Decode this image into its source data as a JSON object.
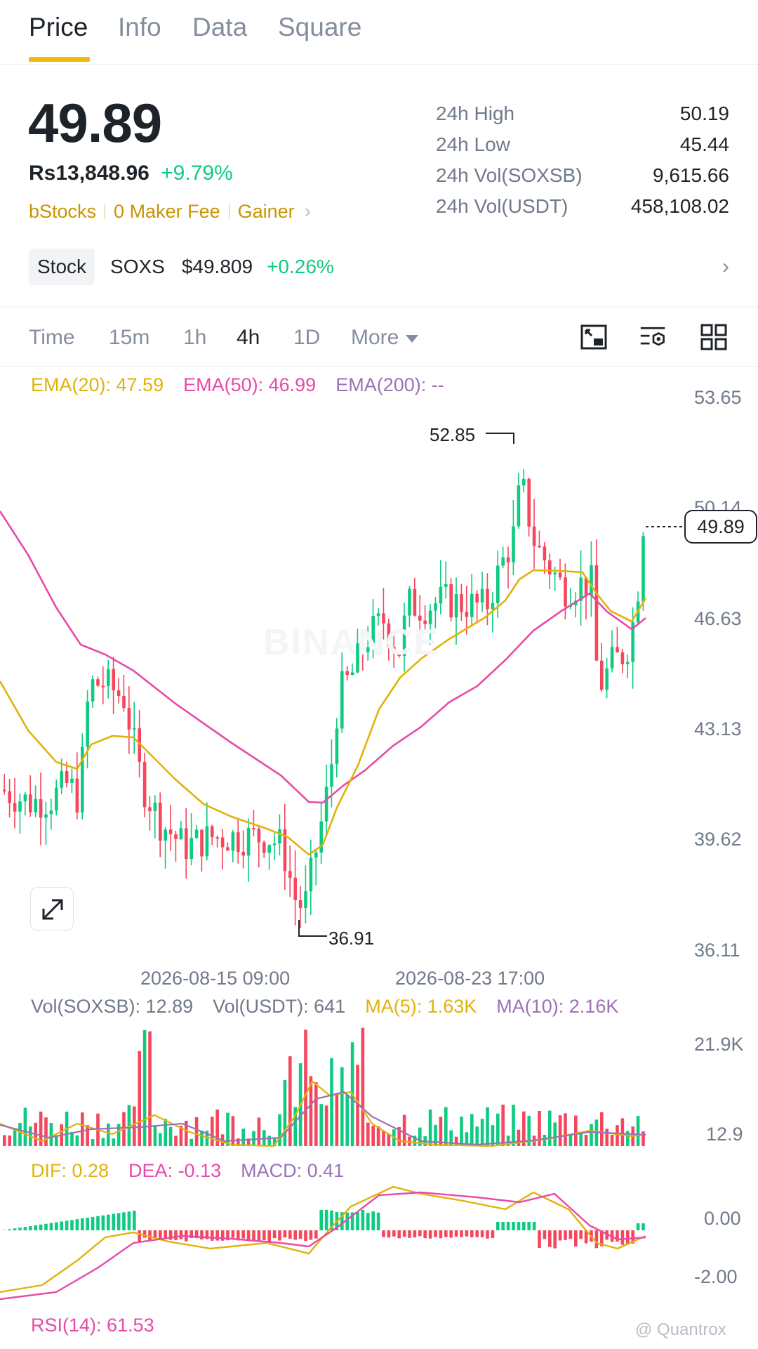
{
  "tabs": [
    {
      "label": "Price",
      "active": true
    },
    {
      "label": "Info",
      "active": false
    },
    {
      "label": "Data",
      "active": false
    },
    {
      "label": "Square",
      "active": false
    }
  ],
  "ticker": {
    "last_price": "49.89",
    "fiat_price": "Rs13,848.96",
    "change_pct": "+9.79%",
    "tags": [
      "bStocks",
      "0 Maker Fee",
      "Gainer"
    ],
    "stats": [
      {
        "label": "24h High",
        "value": "50.19"
      },
      {
        "label": "24h Low",
        "value": "45.44"
      },
      {
        "label": "24h Vol(SOXSB)",
        "value": "9,615.66"
      },
      {
        "label": "24h Vol(USDT)",
        "value": "458,108.02"
      }
    ]
  },
  "stock": {
    "badge": "Stock",
    "symbol": "SOXS",
    "price": "$49.809",
    "change": "+0.26%"
  },
  "timeframes": {
    "items": [
      "Time",
      "15m",
      "1h",
      "4h",
      "1D",
      "More"
    ],
    "active": "4h"
  },
  "icons": [
    "chart-layout-icon",
    "indicator-settings-icon",
    "grid-icon",
    "expand-icon"
  ],
  "colors": {
    "up": "#0ecb81",
    "down": "#f6465d",
    "ema20": "#f0b90b",
    "ema50": "#e84aa8",
    "ema200": "#9b59b6",
    "brand": "#f0b90b"
  },
  "main_chart": {
    "legend": [
      {
        "text": "EMA(20): 47.59",
        "color": "#e2b20a"
      },
      {
        "text": "EMA(50): 46.99",
        "color": "#e84aa8"
      },
      {
        "text": "EMA(200): --",
        "color": "#9b72b6"
      }
    ],
    "y_axis": [
      "53.65",
      "50.14",
      "46.63",
      "43.13",
      "39.62",
      "36.11"
    ],
    "x_axis": [
      "2026-08-15 09:00",
      "2026-08-23 17:00"
    ],
    "last_price_tag": "49.89",
    "high_label": "52.85",
    "low_label": "36.91",
    "watermark": "BINANCE"
  },
  "volume_chart": {
    "legend": [
      {
        "text": "Vol(SOXSB): 12.89",
        "color": "#707a8a"
      },
      {
        "text": "Vol(USDT): 641",
        "color": "#707a8a"
      },
      {
        "text": "MA(5): 1.63K",
        "color": "#e2b20a"
      },
      {
        "text": "MA(10): 2.16K",
        "color": "#9b72b6"
      }
    ],
    "y_axis": [
      "21.9K",
      "12.9"
    ]
  },
  "macd_chart": {
    "legend": [
      {
        "text": "DIF: 0.28",
        "color": "#e2b20a"
      },
      {
        "text": "DEA: -0.13",
        "color": "#e84aa8"
      },
      {
        "text": "MACD: 0.41",
        "color": "#9b72b6"
      }
    ],
    "y_axis": [
      "0.00",
      "-2.00"
    ]
  },
  "rsi_chart": {
    "legend": [
      {
        "text": "RSI(14): 61.53",
        "color": "#e84aa8"
      }
    ]
  },
  "footer_mark": "@ Quantrox"
}
